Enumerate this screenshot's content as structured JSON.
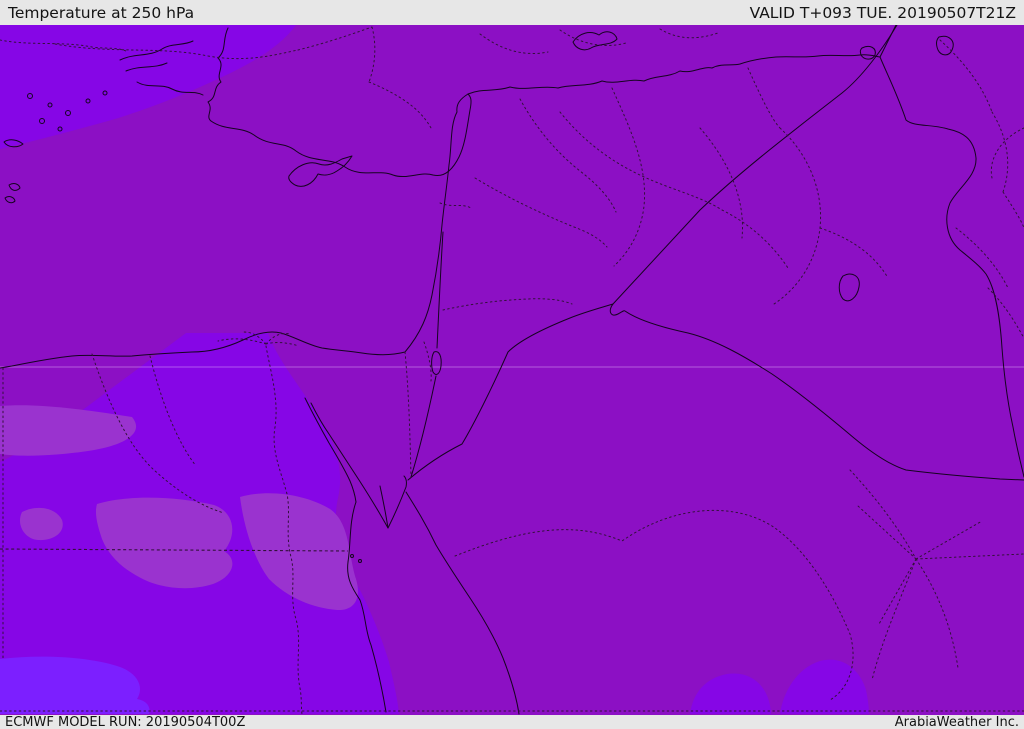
{
  "header": {
    "title": "Temperature at 250 hPa",
    "valid_label": "VALID T+093 TUE. 20190507T21Z"
  },
  "footer": {
    "model_run": "ECMWF MODEL RUN: 20190504T00Z",
    "branding": "ArabiaWeather Inc."
  },
  "map": {
    "colors": {
      "base_purple": "#8C10C4",
      "violet_band": "#8606E6",
      "lavender_band": "#9A33CF",
      "bright_blue_band": "#7C1FFF",
      "border_line": "#160320",
      "admin_line": "#33103a",
      "graticule": "rgba(240,205,255,0.40)",
      "bar_background": "#e7e7e7",
      "bar_text": "#141414"
    }
  }
}
